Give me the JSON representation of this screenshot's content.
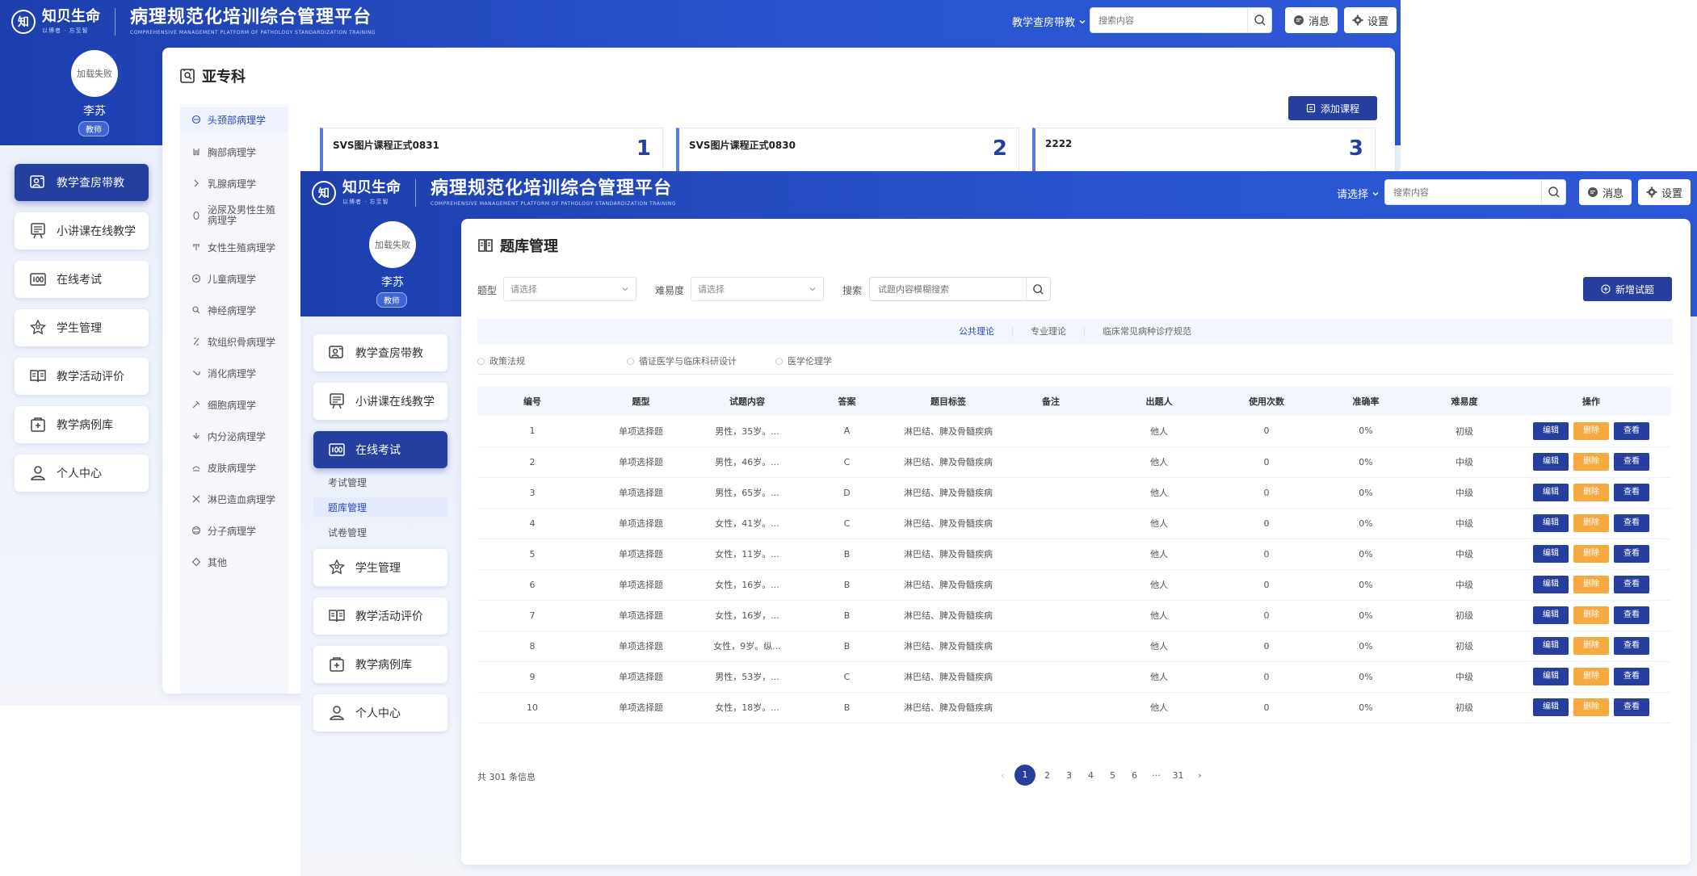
{
  "header": {
    "logo_glyph": "知",
    "logo_name": "知贝生命",
    "logo_slogan": "以博者 · 忘至智",
    "platform_title": "病理规范化培训综合管理平台",
    "platform_subtitle": "COMPREHENSIVE MANAGEMENT PLATFORM OF PATHOLOGY STANDARDIZATION TRAINING",
    "back_nav_select": "教学查房带教",
    "front_nav_select": "请选择",
    "search_placeholder": "搜索内容",
    "messages_label": "消息",
    "settings_label": "设置"
  },
  "user": {
    "avatar_text": "加载失败",
    "name": "李苏",
    "role": "教师"
  },
  "sidebar": {
    "items": [
      {
        "label": "教学查房带教",
        "icon": "teaching-rounds-icon"
      },
      {
        "label": "小讲课在线教学",
        "icon": "lecture-board-icon"
      },
      {
        "label": "在线考试",
        "icon": "exam-100-icon"
      },
      {
        "label": "学生管理",
        "icon": "student-star-icon"
      },
      {
        "label": "教学活动评价",
        "icon": "evaluation-book-icon"
      },
      {
        "label": "教学病例库",
        "icon": "case-library-icon"
      },
      {
        "label": "个人中心",
        "icon": "personal-center-icon"
      }
    ],
    "exam_submenu": [
      "考试管理",
      "题库管理",
      "试卷管理"
    ]
  },
  "back": {
    "page_title": "亚专科",
    "add_course_label": "添加课程",
    "subspecialties": [
      "头颈部病理学",
      "胸部病理学",
      "乳腺病理学",
      "泌尿及男性生殖病理学",
      "女性生殖病理学",
      "儿童病理学",
      "神经病理学",
      "软组织骨病理学",
      "消化病理学",
      "细胞病理学",
      "内分泌病理学",
      "皮肤病理学",
      "淋巴造血病理学",
      "分子病理学",
      "其他"
    ],
    "courses": [
      {
        "title": "SVS图片课程正式0831",
        "num": "1"
      },
      {
        "title": "SVS图片课程正式0830",
        "num": "2"
      },
      {
        "title": "2222",
        "num": "3"
      }
    ]
  },
  "front": {
    "page_title": "题库管理",
    "filters": {
      "type_label": "题型",
      "type_placeholder": "请选择",
      "difficulty_label": "难易度",
      "difficulty_placeholder": "请选择",
      "search_label": "搜索",
      "search_placeholder": "试题内容模糊搜索"
    },
    "add_question_label": "新增试题",
    "tabs": [
      "公共理论",
      "专业理论",
      "临床常见病种诊疗规范"
    ],
    "radios": [
      "政策法规",
      "循证医学与临床科研设计",
      "医学伦理学"
    ],
    "table": {
      "headers": [
        "编号",
        "题型",
        "试题内容",
        "答案",
        "题目标签",
        "备注",
        "出题人",
        "使用次数",
        "准确率",
        "难易度",
        "操作"
      ],
      "rows": [
        [
          "1",
          "单项选择题",
          "男性，35岁。...",
          "A",
          "淋巴结、脾及骨髓疾病",
          "",
          "他人",
          "0",
          "0%",
          "初级"
        ],
        [
          "2",
          "单项选择题",
          "男性，46岁。...",
          "C",
          "淋巴结、脾及骨髓疾病",
          "",
          "他人",
          "0",
          "0%",
          "中级"
        ],
        [
          "3",
          "单项选择题",
          "男性，65岁。...",
          "D",
          "淋巴结、脾及骨髓疾病",
          "",
          "他人",
          "0",
          "0%",
          "中级"
        ],
        [
          "4",
          "单项选择题",
          "女性，41岁。...",
          "C",
          "淋巴结、脾及骨髓疾病",
          "",
          "他人",
          "0",
          "0%",
          "中级"
        ],
        [
          "5",
          "单项选择题",
          "女性，11岁。...",
          "B",
          "淋巴结、脾及骨髓疾病",
          "",
          "他人",
          "0",
          "0%",
          "中级"
        ],
        [
          "6",
          "单项选择题",
          "女性，16岁。...",
          "B",
          "淋巴结、脾及骨髓疾病",
          "",
          "他人",
          "0",
          "0%",
          "中级"
        ],
        [
          "7",
          "单项选择题",
          "女性，16岁，...",
          "B",
          "淋巴结、脾及骨髓疾病",
          "",
          "他人",
          "0",
          "0%",
          "初级"
        ],
        [
          "8",
          "单项选择题",
          "女性，9岁。纵...",
          "B",
          "淋巴结、脾及骨髓疾病",
          "",
          "他人",
          "0",
          "0%",
          "初级"
        ],
        [
          "9",
          "单项选择题",
          "男性，53岁，...",
          "C",
          "淋巴结、脾及骨髓疾病",
          "",
          "他人",
          "0",
          "0%",
          "中级"
        ],
        [
          "10",
          "单项选择题",
          "女性，18岁。...",
          "B",
          "淋巴结、脾及骨髓疾病",
          "",
          "他人",
          "0",
          "0%",
          "初级"
        ]
      ],
      "ops": {
        "edit": "编辑",
        "delete": "删除",
        "view": "查看"
      }
    },
    "total_text": "共 301 条信息",
    "pagination": {
      "prev": "‹",
      "pages": [
        "1",
        "2",
        "3",
        "4",
        "5",
        "6"
      ],
      "ellipsis": "···",
      "last": "31",
      "next": "›",
      "current": "1"
    }
  },
  "colors": {
    "brand": "#2a55cf",
    "primary": "#263f9f",
    "warning": "#f5a93f"
  }
}
